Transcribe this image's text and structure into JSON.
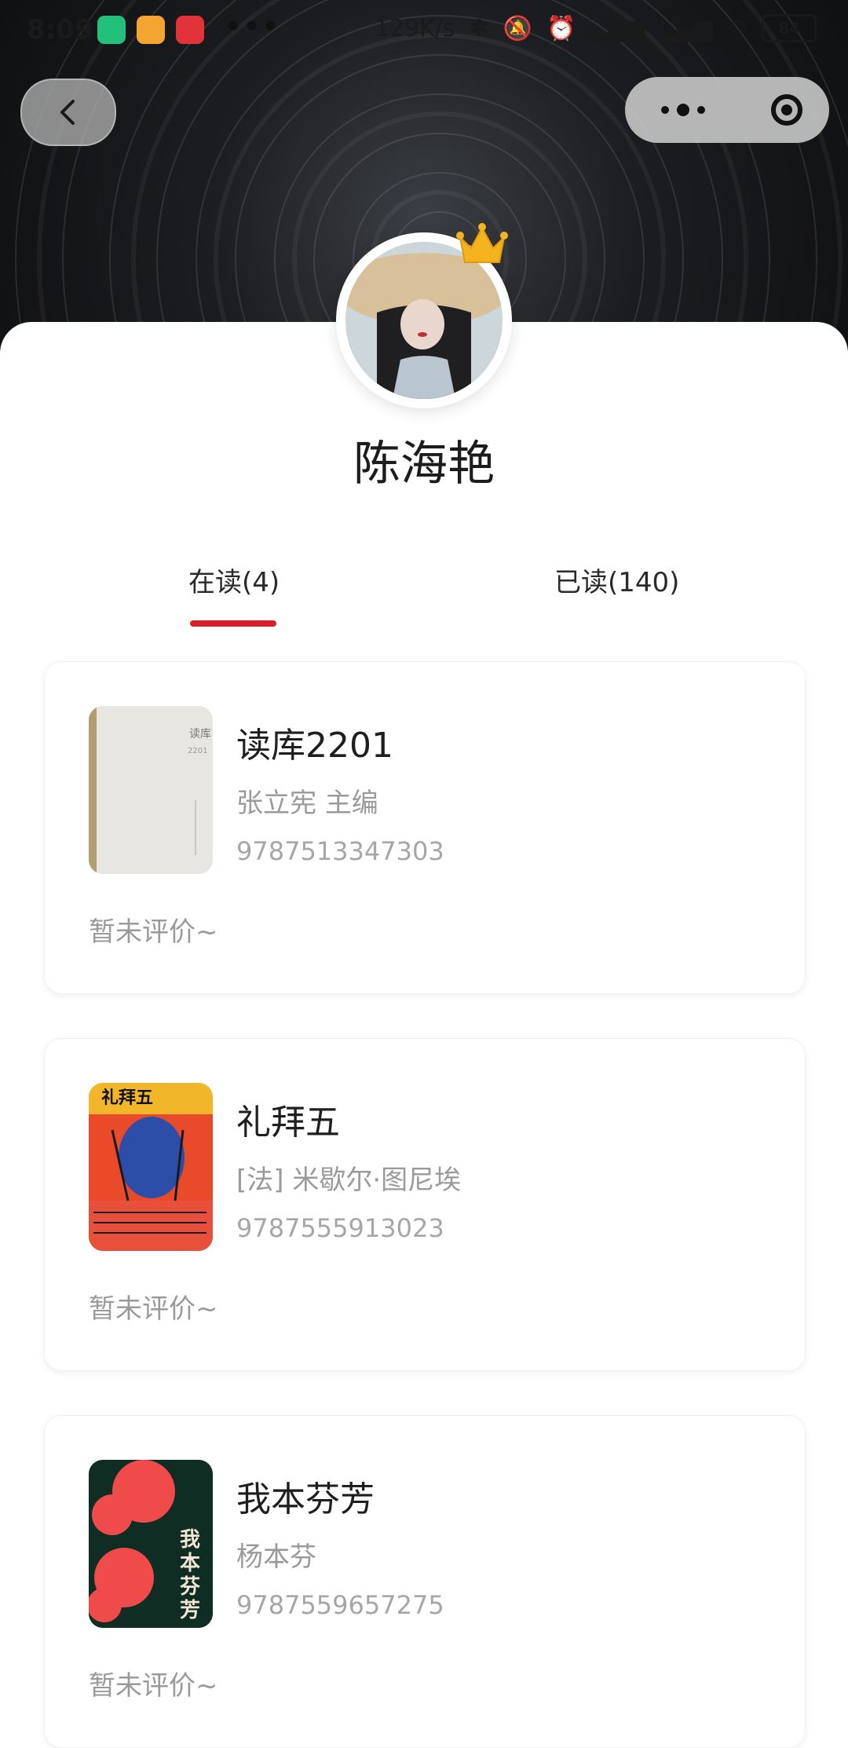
{
  "status_bar": {
    "time": "8:09",
    "more": "•••",
    "speed": "129K/s",
    "battery": "84"
  },
  "profile": {
    "name": "陈海艳"
  },
  "tabs": [
    {
      "label": "在读(4)",
      "active": true
    },
    {
      "label": "已读(140)",
      "active": false
    }
  ],
  "books": [
    {
      "title": "读库2201",
      "author": "张立宪 主编",
      "isbn": "9787513347303",
      "review": "暂未评价~",
      "cover_color": "#e9e8e3"
    },
    {
      "title": "礼拜五",
      "author": "[法] 米歇尔·图尼埃",
      "isbn": "9787555913023",
      "review": "暂未评价~",
      "cover_color": "#e84a2a"
    },
    {
      "title": "我本芬芳",
      "author": "杨本芬",
      "isbn": "9787559657275",
      "review": "暂未评价~",
      "cover_color": "#0f2d22"
    }
  ],
  "colors": {
    "accent": "#d6202c",
    "header_bg": "#1c1d20"
  }
}
